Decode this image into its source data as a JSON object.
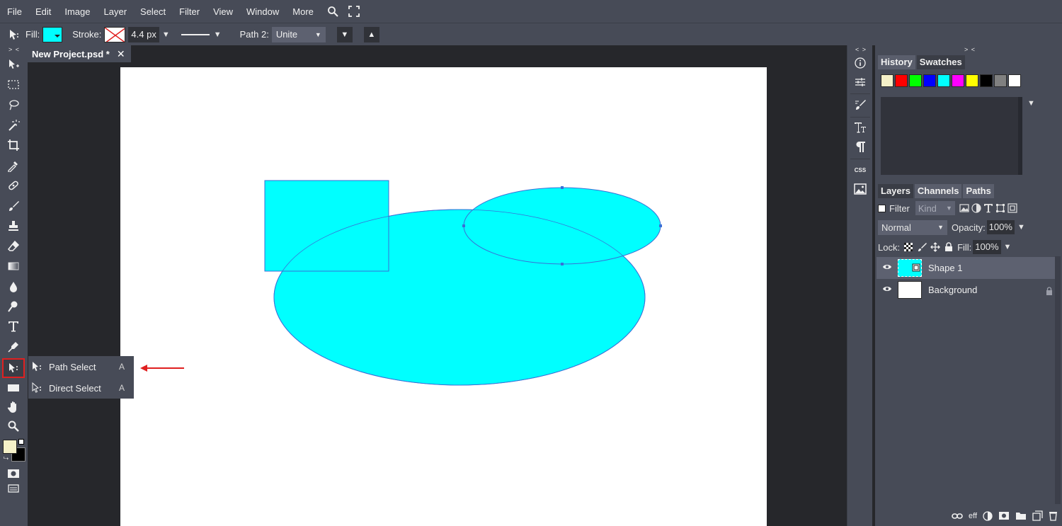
{
  "menubar": {
    "items": [
      "File",
      "Edit",
      "Image",
      "Layer",
      "Select",
      "Filter",
      "View",
      "Window",
      "More"
    ]
  },
  "options": {
    "fill_label": "Fill:",
    "fill_color": "#00ffff",
    "stroke_label": "Stroke:",
    "stroke_width": "4.4 px",
    "path_label": "Path 2:",
    "path_op": "Unite"
  },
  "document": {
    "tab_title": "New Project.psd *",
    "close_glyph": "✕"
  },
  "toolbar": {
    "collapse": "> <",
    "foreground_color": "#f5f1c8",
    "background_color": "#000000"
  },
  "flyout": {
    "items": [
      {
        "label": "Path Select",
        "key": "A"
      },
      {
        "label": "Direct Select",
        "key": "A"
      }
    ]
  },
  "iconstrip": {
    "collapse": "< >",
    "css_label": "CSS"
  },
  "history_panel": {
    "collapse": "> <",
    "tabs": [
      "History",
      "Swatches"
    ],
    "swatches": [
      "#f5f1c8",
      "#ff0000",
      "#00ff00",
      "#0000ff",
      "#00ffff",
      "#ff00ff",
      "#ffff00",
      "#000000",
      "#808080",
      "#ffffff"
    ]
  },
  "layers_panel": {
    "tabs": [
      "Layers",
      "Channels",
      "Paths"
    ],
    "filter_label": "Filter",
    "kind_label": "Kind",
    "blend_mode": "Normal",
    "opacity_label": "Opacity:",
    "opacity_value": "100%",
    "lock_label": "Lock:",
    "fill_label": "Fill:",
    "fill_value": "100%",
    "layers": [
      {
        "name": "Shape 1",
        "selected": true
      },
      {
        "name": "Background",
        "selected": false
      }
    ],
    "eff_label": "eff"
  },
  "colors": {
    "accent_shape": "#00ffff",
    "shape_stroke": "#3a6fd6",
    "highlight": "#e02020"
  }
}
